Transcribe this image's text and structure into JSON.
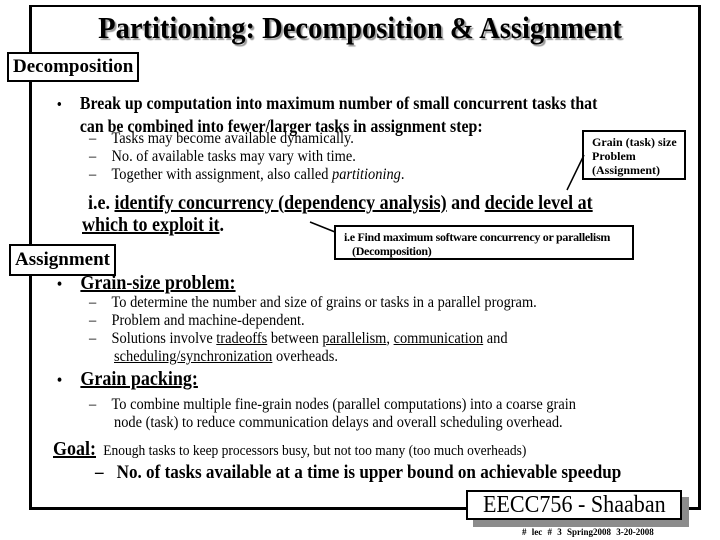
{
  "slide": {
    "title": "Partitioning: Decomposition & Assignment",
    "sections": {
      "decomposition": {
        "label": "Decomposition",
        "bullet_symbol": "•",
        "main_point_line1": "Break up computation into maximum number of small concurrent tasks that",
        "main_point_line2": "can be combined into fewer/larger tasks in assignment step:",
        "sub_points": [
          "Tasks may become available dynamically.",
          "No. of available tasks may vary with time.",
          "Together with assignment, also called "
        ],
        "sub_point3_italic": "partitioning",
        "sub_point3_end": ".",
        "ie_prefix": "i.e. ",
        "ie_link1": "identify concurrency (dependency analysis)",
        "ie_mid": " and ",
        "ie_link2a": "decide level at",
        "ie_link2b": "which to exploit it",
        "ie_end": "."
      },
      "assignment": {
        "label": "Assignment",
        "grain_size": {
          "heading": "Grain-size problem:",
          "sub_points": [
            "To determine the number and size of grains or tasks in a parallel program.",
            "Problem and machine-dependent."
          ],
          "solutions": {
            "prefix": "Solutions involve ",
            "tradeoffs": "tradeoffs",
            "between": " between ",
            "parallelism": "parallelism",
            "comma": ", ",
            "communication": "communication",
            "and": " and",
            "scheduling": "scheduling/synchronization",
            "end": " overheads."
          }
        },
        "grain_packing": {
          "heading": "Grain packing:",
          "line1": "To combine multiple fine-grain nodes (parallel computations) into a coarse grain",
          "line2": "node  (task) to reduce communication delays and overall scheduling overhead."
        }
      }
    },
    "callouts": {
      "grain": [
        "Grain (task) size",
        "Problem",
        "(Assignment)"
      ],
      "find": [
        "i.e Find maximum software concurrency or parallelism",
        "(Decomposition)"
      ]
    },
    "goal": {
      "label": "Goal:",
      "text": "Enough tasks to keep processors busy, but not too many (too much overheads)",
      "sub": "No. of tasks available at a time is upper bound on achievable speedup"
    },
    "dash": "–",
    "footer": {
      "course": "EECC756 - Shaaban",
      "meta": "#  lec # 3  Spring2008  3-20-2008"
    }
  }
}
